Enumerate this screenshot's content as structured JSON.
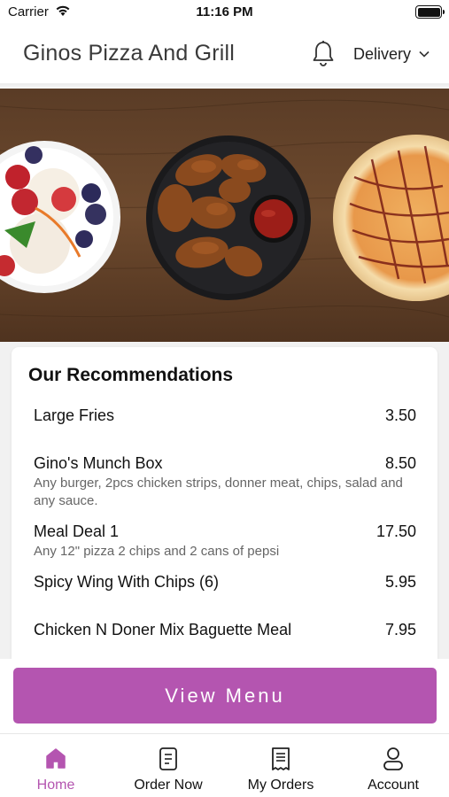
{
  "status_bar": {
    "carrier": "Carrier",
    "time": "11:16 PM"
  },
  "header": {
    "title": "Ginos Pizza And Grill",
    "notification_icon": "bell-icon",
    "delivery_label": "Delivery",
    "delivery_icon": "chevron-down-icon"
  },
  "hero": {
    "description_icon": "food-banner"
  },
  "recommendations": {
    "title": "Our Recommendations",
    "items": [
      {
        "name": "Large Fries",
        "price": "3.50",
        "description": ""
      },
      {
        "name": "Gino's Munch Box",
        "price": "8.50",
        "description": "Any burger, 2pcs chicken strips, donner meat, chips, salad and any sauce."
      },
      {
        "name": "Meal Deal 1",
        "price": "17.50",
        "description": "Any 12\" pizza 2 chips and 2 cans of pepsi"
      },
      {
        "name": "Spicy Wing With Chips (6)",
        "price": "5.95",
        "description": ""
      },
      {
        "name": "Chicken N Doner Mix Baguette Meal",
        "price": "7.95",
        "description": ""
      }
    ]
  },
  "view_menu": {
    "label": "View Menu"
  },
  "tabs": [
    {
      "label": "Home",
      "icon": "home-icon",
      "active": true
    },
    {
      "label": "Order Now",
      "icon": "order-icon",
      "active": false
    },
    {
      "label": "My Orders",
      "icon": "receipt-icon",
      "active": false
    },
    {
      "label": "Account",
      "icon": "user-icon",
      "active": false
    }
  ],
  "colors": {
    "accent": "#b455b0",
    "text": "#111111",
    "muted": "#666666"
  }
}
